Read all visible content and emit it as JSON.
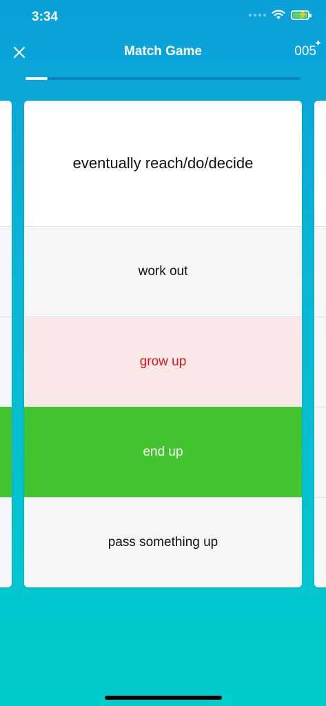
{
  "status_bar": {
    "time": "3:34",
    "icons": [
      "cellular-dots-icon",
      "wifi-icon",
      "battery-charging-icon"
    ],
    "battery_color": "#4cd964"
  },
  "header": {
    "title": "Match Game",
    "counter": "005",
    "progress_fraction": 0.08
  },
  "card": {
    "prompt": "eventually reach/do/decide",
    "options": [
      {
        "label": "work out",
        "state": "neutral"
      },
      {
        "label": "grow up",
        "state": "wrong"
      },
      {
        "label": "end up",
        "state": "correct"
      },
      {
        "label": "pass something up",
        "state": "neutral"
      }
    ]
  },
  "colors": {
    "correct": "#42c52f",
    "wrong_text": "#e8101a",
    "wrong_bg": "#fbe9e9",
    "option_bg": "#f6f5f8"
  }
}
